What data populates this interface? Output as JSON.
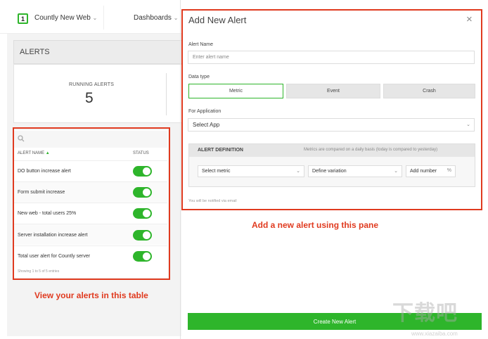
{
  "topbar": {
    "app_badge": "1",
    "app_name": "Countly New Web",
    "dashboards": "Dashboards"
  },
  "alerts_panel": {
    "header": "ALERTS",
    "running_label": "RUNNING ALERTS",
    "running_count": "5",
    "columns": {
      "name": "ALERT NAME",
      "status": "STATUS"
    },
    "rows": [
      {
        "name": "DO button increase alert",
        "enabled": true
      },
      {
        "name": "Form submit increase",
        "enabled": true
      },
      {
        "name": "New web - total users 25%",
        "enabled": true
      },
      {
        "name": "Server installation increase alert",
        "enabled": true
      },
      {
        "name": "Total user alert for Countly server",
        "enabled": true
      }
    ],
    "footer": "Showing 1 to 5 of 5 entries",
    "caption": "View your alerts in this table"
  },
  "add_alert": {
    "title": "Add New Alert",
    "alert_name_label": "Alert Name",
    "alert_name_placeholder": "Enter alert name",
    "data_type_label": "Data type",
    "data_types": [
      "Metric",
      "Event",
      "Crash"
    ],
    "active_data_type": "Metric",
    "for_app_label": "For Application",
    "select_app": "Select App",
    "definition_title": "ALERT DEFINITION",
    "definition_note": "Metrics are compared on a daily basis (today is compared to yesterday)",
    "select_metric": "Select metric",
    "define_variation": "Define variation",
    "add_number": "Add number",
    "percent": "%",
    "notified_note": "You will be notified via email",
    "caption": "Add a new alert using this pane",
    "create_button": "Create New Alert"
  },
  "watermark": {
    "text": "下载吧",
    "url": "www.xiazaiba.com"
  },
  "colors": {
    "accent": "#2eb52b",
    "annotation": "#e03a1f"
  }
}
